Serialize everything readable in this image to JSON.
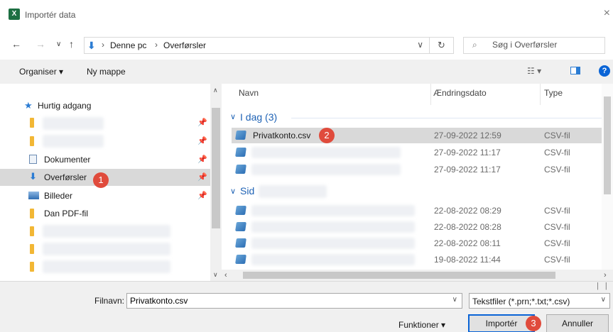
{
  "window": {
    "title": "Importér data",
    "app_icon_letter": "X",
    "close_glyph": "×"
  },
  "address": {
    "crumbs": [
      "Denne pc",
      "Overførsler"
    ],
    "search_placeholder": "Søg i Overførsler"
  },
  "toolbar": {
    "organise": "Organiser ▾",
    "new_folder": "Ny mappe"
  },
  "nav": {
    "quick_access": "Hurtig adgang",
    "items": [
      {
        "label": "Dokumenter"
      },
      {
        "label": "Overførsler"
      },
      {
        "label": "Billeder"
      },
      {
        "label": "Dan PDF-fil"
      }
    ]
  },
  "files": {
    "columns": {
      "name": "Navn",
      "date": "Ændringsdato",
      "type": "Type"
    },
    "group_today": "I dag (3)",
    "group_earlier": "Sid",
    "rows": [
      {
        "name": "Privatkonto.csv",
        "date": "27-09-2022 12:59",
        "type": "CSV-fil",
        "selected": true
      },
      {
        "name": "",
        "date": "27-09-2022 11:17",
        "type": "CSV-fil"
      },
      {
        "name": "",
        "date": "27-09-2022 11:17",
        "type": "CSV-fil"
      },
      {
        "name": "",
        "date": "22-08-2022 08:29",
        "type": "CSV-fil"
      },
      {
        "name": "",
        "date": "22-08-2022 08:28",
        "type": "CSV-fil"
      },
      {
        "name": "",
        "date": "22-08-2022 08:11",
        "type": "CSV-fil"
      },
      {
        "name": "",
        "date": "19-08-2022 11:44",
        "type": "CSV-fil"
      }
    ]
  },
  "bottom": {
    "filename_label": "Filnavn:",
    "filename_value": "Privatkonto.csv",
    "filetype": "Tekstfiler (*.prn;*.txt;*.csv)",
    "functions": "Funktioner",
    "import": "Importér",
    "cancel": "Annuller"
  },
  "badges": [
    "1",
    "2",
    "3"
  ],
  "colors": {
    "accent": "#0a64d6",
    "badge": "#e04b3c",
    "selection": "#d9d9d9",
    "group_heading": "#1e62b5"
  }
}
